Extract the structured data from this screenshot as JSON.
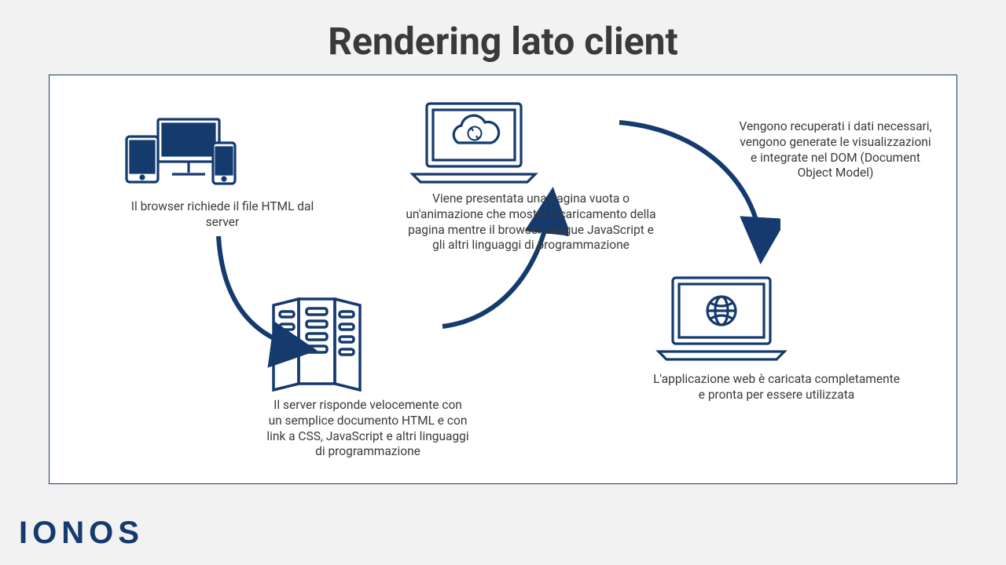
{
  "title": "Rendering lato client",
  "steps": {
    "s1": "Il browser richiede il file HTML dal server",
    "s2": "Il server risponde velocemente con un semplice documento HTML e con link a CSS, JavaScript e altri linguaggi di programmazione",
    "s3": "Viene presentata una pagina vuota o un'animazione che mostra il caricamento della pagina mentre il browser esegue JavaScript e gli altri linguaggi di programmazione",
    "s4": "Vengono recuperati i dati necessari, vengono generate le visualizzazioni e integrate nel DOM (Document Object Model)",
    "s5": "L'applicazione web è caricata completamente e pronta per essere utilizzata"
  },
  "brand": "IONOS",
  "colors": {
    "accent": "#143a6e"
  }
}
